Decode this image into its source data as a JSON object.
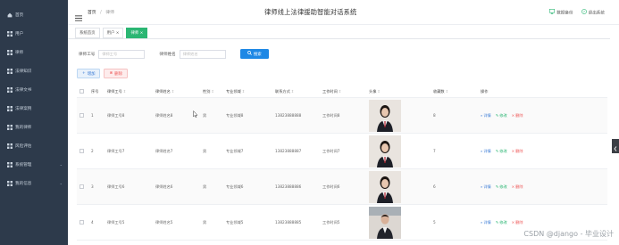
{
  "sidebar": {
    "items": [
      {
        "label": "首页",
        "icon": "home-icon"
      },
      {
        "label": "用户",
        "icon": "grid-icon"
      },
      {
        "label": "律师",
        "icon": "grid-icon"
      },
      {
        "label": "法律知识",
        "icon": "grid-icon"
      },
      {
        "label": "法律文书",
        "icon": "grid-icon"
      },
      {
        "label": "法律案例",
        "icon": "grid-icon"
      },
      {
        "label": "我的律师",
        "icon": "grid-icon"
      },
      {
        "label": "风险评估",
        "icon": "grid-icon"
      },
      {
        "label": "系统管理",
        "icon": "grid-icon",
        "expandable": true
      },
      {
        "label": "我的信息",
        "icon": "grid-icon",
        "expandable": true
      }
    ]
  },
  "header": {
    "breadcrumb": {
      "home": "首页",
      "separator": "/",
      "current": "律师"
    },
    "title": "律师线上法律援助智能对话系统",
    "backup_label": "数据备份",
    "logout_label": "退出系统"
  },
  "tabs": [
    {
      "label": "系统首页",
      "closable": false,
      "active": false
    },
    {
      "label": "用户",
      "closable": true,
      "active": false
    },
    {
      "label": "律师",
      "closable": true,
      "active": true
    }
  ],
  "search": {
    "fields": [
      {
        "label": "律师工号",
        "placeholder": "律师工号"
      },
      {
        "label": "律师姓名",
        "placeholder": "律师姓名"
      }
    ],
    "button_label": "搜索"
  },
  "actions": {
    "add_label": "增加",
    "delete_label": "删除"
  },
  "table": {
    "columns": [
      "序号",
      "律师工号",
      "律师姓名",
      "性别",
      "专业领域",
      "联系方式",
      "工作时间",
      "头像",
      "收藏数",
      "操作"
    ],
    "rows": [
      {
        "index": "1",
        "id": "律师工号8",
        "name": "律师姓名8",
        "gender": "男",
        "field": "专业领域8",
        "phone": "13823888888",
        "time": "工作时间8",
        "favorites": "8"
      },
      {
        "index": "2",
        "id": "律师工号7",
        "name": "律师姓名7",
        "gender": "男",
        "field": "专业领域7",
        "phone": "13823888887",
        "time": "工作时间7",
        "favorites": "7"
      },
      {
        "index": "3",
        "id": "律师工号6",
        "name": "律师姓名6",
        "gender": "男",
        "field": "专业领域6",
        "phone": "13823888886",
        "time": "工作时间6",
        "favorites": "6"
      },
      {
        "index": "4",
        "id": "律师工号5",
        "name": "律师姓名5",
        "gender": "男",
        "field": "专业领域5",
        "phone": "13823888885",
        "time": "工作时间5",
        "favorites": "5"
      }
    ],
    "ops": {
      "detail": "详情",
      "edit": "修改",
      "remove": "删除"
    }
  },
  "watermark": "CSDN @django - 毕业设计",
  "colors": {
    "sidebar_bg": "#2d3a4b",
    "accent_blue": "#1e88e5",
    "accent_green": "#2bb673",
    "danger": "#e55555"
  }
}
